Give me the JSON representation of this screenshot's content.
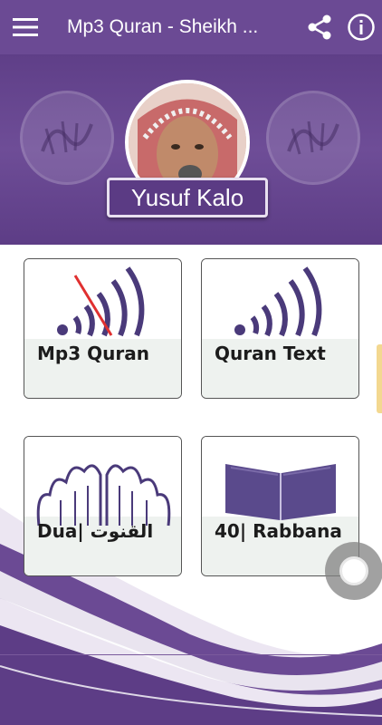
{
  "appbar": {
    "title": "Mp3 Quran - Sheikh ...",
    "menu_icon": "hamburger-menu-icon",
    "share_icon": "share-icon",
    "info_icon": "info-icon",
    "color": "#6b4a94"
  },
  "banner": {
    "reciter_name": "Yusuf Kalo"
  },
  "cards": [
    {
      "label": "Mp3 Quran",
      "icon": "audio-waves-muted-icon"
    },
    {
      "label": "Quran Text",
      "icon": "audio-waves-icon"
    },
    {
      "label": "Dua| القنوت",
      "icon": "praying-hands-icon"
    },
    {
      "label": "40| Rabbana",
      "icon": "open-book-icon"
    }
  ],
  "colors": {
    "primary": "#6b4a94",
    "card_bottom": "#eef2ef",
    "mute_slash": "#e03030"
  }
}
